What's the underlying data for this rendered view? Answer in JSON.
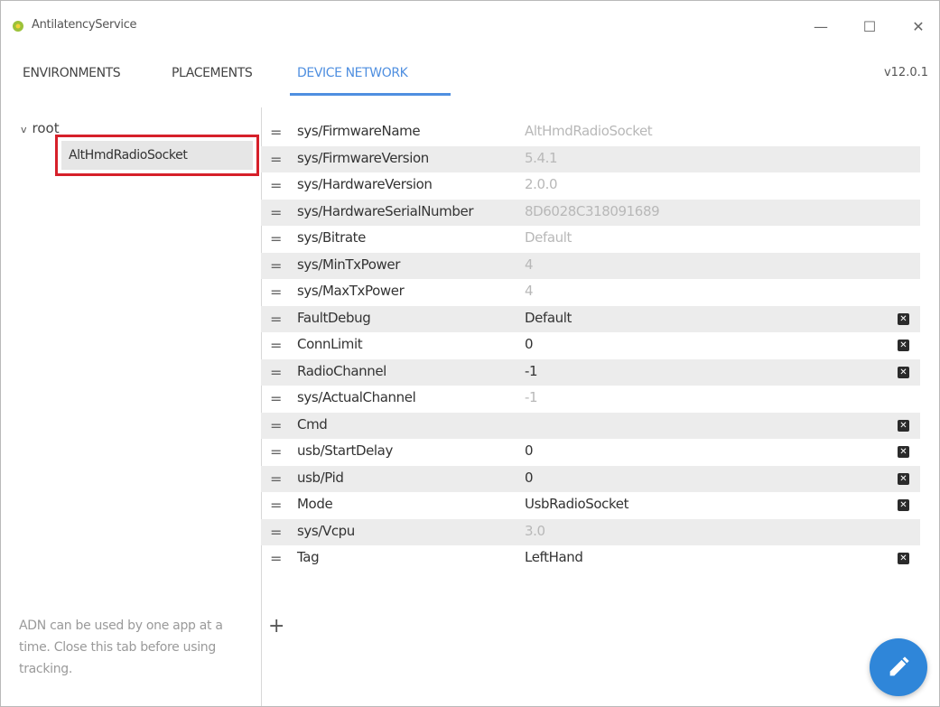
{
  "window": {
    "title": "AntilatencyService",
    "minimize_glyph": "—",
    "maximize_glyph": "☐",
    "close_glyph": "✕"
  },
  "tabs": [
    {
      "label": "ENVIRONMENTS",
      "active": false
    },
    {
      "label": "PLACEMENTS",
      "active": false
    },
    {
      "label": "DEVICE NETWORK",
      "active": true
    }
  ],
  "version": "v12.0.1",
  "tree": {
    "root_label": "root",
    "selected_child": "AltHmdRadioSocket"
  },
  "hint_text": "ADN can be used by one app at a time. Close this tab before using tracking.",
  "properties": [
    {
      "key": "sys/FirmwareName",
      "value": "AltHmdRadioSocket",
      "readonly": true,
      "deletable": false
    },
    {
      "key": "sys/FirmwareVersion",
      "value": "5.4.1",
      "readonly": true,
      "deletable": false
    },
    {
      "key": "sys/HardwareVersion",
      "value": "2.0.0",
      "readonly": true,
      "deletable": false
    },
    {
      "key": "sys/HardwareSerialNumber",
      "value": "8D6028C318091689",
      "readonly": true,
      "deletable": false
    },
    {
      "key": "sys/Bitrate",
      "value": "Default",
      "readonly": true,
      "deletable": false
    },
    {
      "key": "sys/MinTxPower",
      "value": "4",
      "readonly": true,
      "deletable": false
    },
    {
      "key": "sys/MaxTxPower",
      "value": "4",
      "readonly": true,
      "deletable": false
    },
    {
      "key": "FaultDebug",
      "value": "Default",
      "readonly": false,
      "deletable": true
    },
    {
      "key": "ConnLimit",
      "value": "0",
      "readonly": false,
      "deletable": true
    },
    {
      "key": "RadioChannel",
      "value": "-1",
      "readonly": false,
      "deletable": true
    },
    {
      "key": "sys/ActualChannel",
      "value": "-1",
      "readonly": true,
      "deletable": false
    },
    {
      "key": "Cmd",
      "value": "",
      "readonly": false,
      "deletable": true
    },
    {
      "key": "usb/StartDelay",
      "value": "0",
      "readonly": false,
      "deletable": true
    },
    {
      "key": "usb/Pid",
      "value": "0",
      "readonly": false,
      "deletable": true
    },
    {
      "key": "Mode",
      "value": "UsbRadioSocket",
      "readonly": false,
      "deletable": true
    },
    {
      "key": "sys/Vcpu",
      "value": "3.0",
      "readonly": true,
      "deletable": false
    },
    {
      "key": "Tag",
      "value": "LeftHand",
      "readonly": false,
      "deletable": true
    }
  ],
  "icons": {
    "app": "antilatency-logo-icon",
    "drag_handle": "drag-handle-icon",
    "delete": "delete-property-icon",
    "add": "add-property-icon",
    "edit": "pencil-icon"
  },
  "glyphs": {
    "handle": "=",
    "delete": "✕",
    "add": "+",
    "tree_chevron": "v"
  },
  "colors": {
    "accent": "#4f8fe0",
    "fab": "#2f86d9",
    "selection_border": "#d6202a",
    "alt_row": "#ececec"
  }
}
